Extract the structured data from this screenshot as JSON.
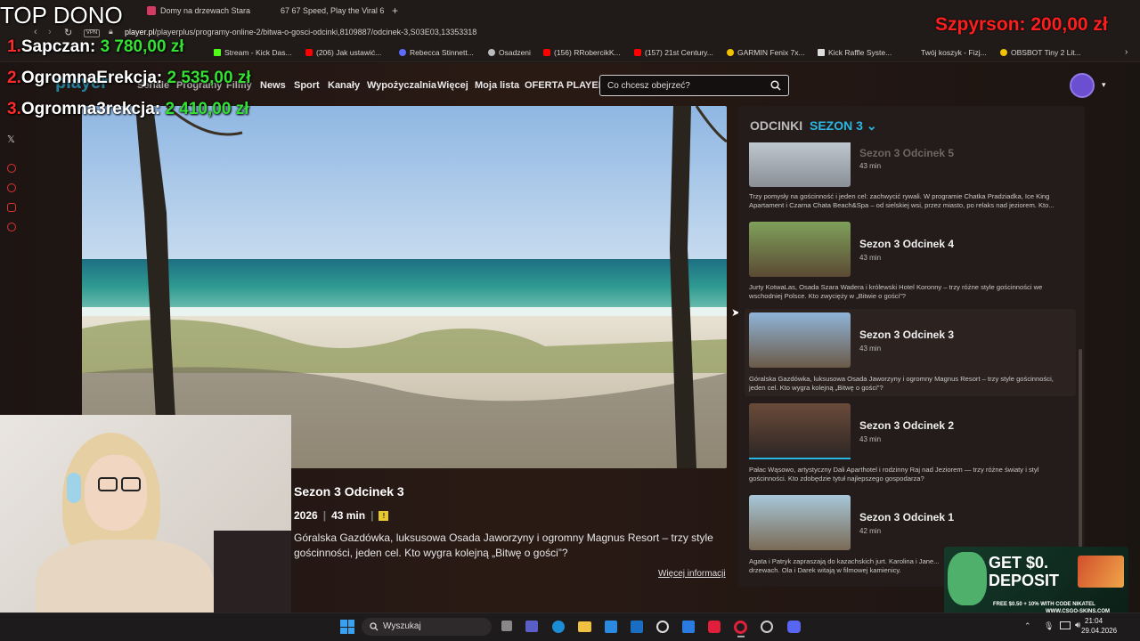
{
  "browser": {
    "tabs": [
      {
        "label": "Domy na drzewach Stara",
        "color": "#d33b63"
      },
      {
        "label": "67  67 Speed, Play the Viral 6",
        "color": "#444444"
      }
    ],
    "url_host": "player.pl",
    "url_path": "/playerplus/programy-online-2/bitwa-o-gosci-odcinki,8109887/odcinek-3,S03E03,13353318",
    "bookmarks": [
      {
        "label": "Stream - Kick Das...",
        "color": "#53fc18"
      },
      {
        "label": "(206) Jak ustawić...",
        "color": "#ff0000"
      },
      {
        "label": "Rebecca Stinnett...",
        "color": "#5b6cff"
      },
      {
        "label": "Osadzeni",
        "color": "#bbbbbb"
      },
      {
        "label": "(156) RRobercikK...",
        "color": "#ff0000"
      },
      {
        "label": "(157) 21st Century...",
        "color": "#ff0000"
      },
      {
        "label": "GARMIN Fenix 7x...",
        "color": "#f2c200"
      },
      {
        "label": "Kick Raffle Syste...",
        "color": "#dddddd"
      },
      {
        "label": "Twój koszyk - Fizj...",
        "color": "#dddddd"
      },
      {
        "label": "OBSBOT Tiny 2 Lit...",
        "color": "#f2c200"
      }
    ]
  },
  "site": {
    "logo": "player",
    "nav": [
      "Seriale",
      "Programy",
      "Filmy",
      "News",
      "Sport",
      "Kanały",
      "Wypożyczalnia",
      "Więcej",
      "Moja lista",
      "OFERTA PLAYER"
    ],
    "search_placeholder": "Co chcesz obejrzeć?"
  },
  "episode": {
    "title": "Sezon 3 Odcinek 3",
    "year": "2026",
    "duration": "43 min",
    "rating": "!",
    "description": "Góralska Gazdówka, luksusowa Osada Jaworzyny i ogromny Magnus Resort – trzy style gościnności, jeden cel. Kto wygra kolejną „Bitwę o gości”?",
    "more_info": "Więcej informacji"
  },
  "panel": {
    "heading": "ODCINKI",
    "season": "SEZON 3",
    "episodes": [
      {
        "title": "Sezon 3 Odcinek 5",
        "duration": "43 min",
        "description": "Trzy pomysły na gościnność i jeden cel: zachwycić rywali. W programie Chatka Pradziadka, Ice King Apartament i Czarna Chata Beach&Spa – od sielskiej wsi, przez miasto, po relaks nad jeziorem. Kto..."
      },
      {
        "title": "Sezon 3 Odcinek 4",
        "duration": "43 min",
        "description": "Jurty KotwaLas, Osada Szara Wadera i królewski Hotel Koronny – trzy różne style gościnności we wschodniej Polsce. Kto zwycięży w „Bitwie o gości”?"
      },
      {
        "title": "Sezon 3 Odcinek 3",
        "duration": "43 min",
        "description": "Góralska Gazdówka, luksusowa Osada Jaworzyny i ogromny Magnus Resort – trzy style gościnności, jeden cel. Kto wygra kolejną „Bitwę o gości”?"
      },
      {
        "title": "Sezon 3 Odcinek 2",
        "duration": "43 min",
        "description": "Pałac Wąsowo, artystyczny Dali Aparthotel i rodzinny Raj nad Jeziorem — trzy różne światy i styl gościnności. Kto zdobędzie tytuł najlepszego gospodarza?"
      },
      {
        "title": "Sezon 3 Odcinek 1",
        "duration": "42 min",
        "description": "Agata i Patryk zapraszają do kazachskich jurt. Karolina i Jane... drzewach. Ola i Darek witają w filmowej kamienicy."
      }
    ]
  },
  "overlay": {
    "top_title": "TOP DONO",
    "donors": [
      {
        "rank": "1.",
        "name": "Sapczan:",
        "amount": "3 780,00 zł"
      },
      {
        "rank": "2.",
        "name": "OgromnaErekcja:",
        "amount": "2 535,00 zł"
      },
      {
        "rank": "3.",
        "name": "Ogromna3rekcja:",
        "amount": "2 410,00 zł"
      }
    ],
    "last_donor_name": "Szpyrson",
    "last_donor_amount": ": 200,00 zł",
    "ad_title": "GET $0.",
    "ad_title2": "DEPOSIT",
    "ad_code": "FREE $0.50 + 10% WITH CODE NIKATEL",
    "ad_site": "WWW.CSGO-SKINS.COM"
  },
  "taskbar": {
    "search_label": "Wyszukaj",
    "time": "21:04",
    "date": "29.04.2026"
  }
}
